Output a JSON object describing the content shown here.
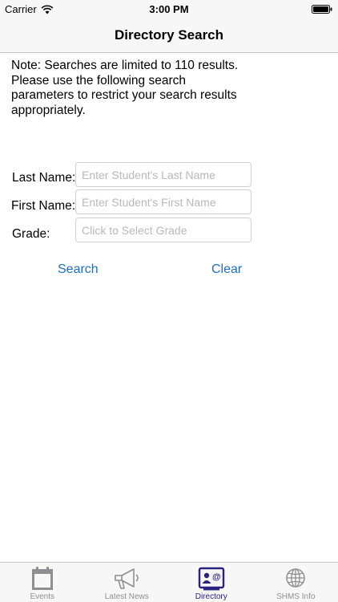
{
  "status_bar": {
    "carrier": "Carrier",
    "time": "3:00 PM",
    "icons": [
      "wifi-icon",
      "battery-icon"
    ]
  },
  "nav": {
    "title": "Directory Search"
  },
  "note": {
    "text": "Note: Searches are limited to 110 results. Please use the following search parameters to restrict your search results appropriately."
  },
  "form": {
    "last_name": {
      "label": "Last Name:",
      "placeholder": "Enter Student's Last Name",
      "value": ""
    },
    "first_name": {
      "label": "First Name:",
      "placeholder": "Enter Student's First Name",
      "value": ""
    },
    "grade": {
      "label": "Grade:",
      "placeholder": "Click to Select Grade",
      "value": ""
    },
    "search_label": "Search",
    "clear_label": "Clear"
  },
  "tabs": [
    {
      "label": "Events",
      "icon": "calendar-icon",
      "active": false
    },
    {
      "label": "Latest News",
      "icon": "megaphone-icon",
      "active": false
    },
    {
      "label": "Directory",
      "icon": "directory-card-icon",
      "active": true
    },
    {
      "label": "SHMS Info",
      "icon": "globe-icon",
      "active": false
    }
  ],
  "colors": {
    "accent_link": "#1b6fc9",
    "active_tab": "#2b2280",
    "inactive_tab": "#8e8e93",
    "bar_background": "#f7f7f7"
  }
}
